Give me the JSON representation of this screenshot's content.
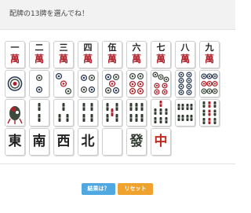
{
  "prompt": {
    "text": "配牌の13牌を選んでね！"
  },
  "tiles": {
    "manzu": {
      "suit_symbol": "萬",
      "numerals": [
        "一",
        "二",
        "三",
        "四",
        "伍",
        "六",
        "七",
        "八",
        "九"
      ],
      "icon": "man-tile-icon"
    },
    "pinzu": {
      "count": 9,
      "icon": "pin-tile-icon"
    },
    "souzu": {
      "count": 9,
      "icon": "sou-tile-icon"
    },
    "honors": {
      "labels": [
        "東",
        "南",
        "西",
        "北",
        "",
        "發",
        "中"
      ],
      "icon": "honor-tile-icon"
    }
  },
  "colors": {
    "man_red": "#b1202a",
    "chun_red": "#c42a1f",
    "hatsu_green": "#2f3a2e",
    "result_blue": "#4fa8e0",
    "reset_orange": "#f0a22e"
  },
  "buttons": {
    "result_label": "結果は？",
    "reset_label": "リセット"
  }
}
